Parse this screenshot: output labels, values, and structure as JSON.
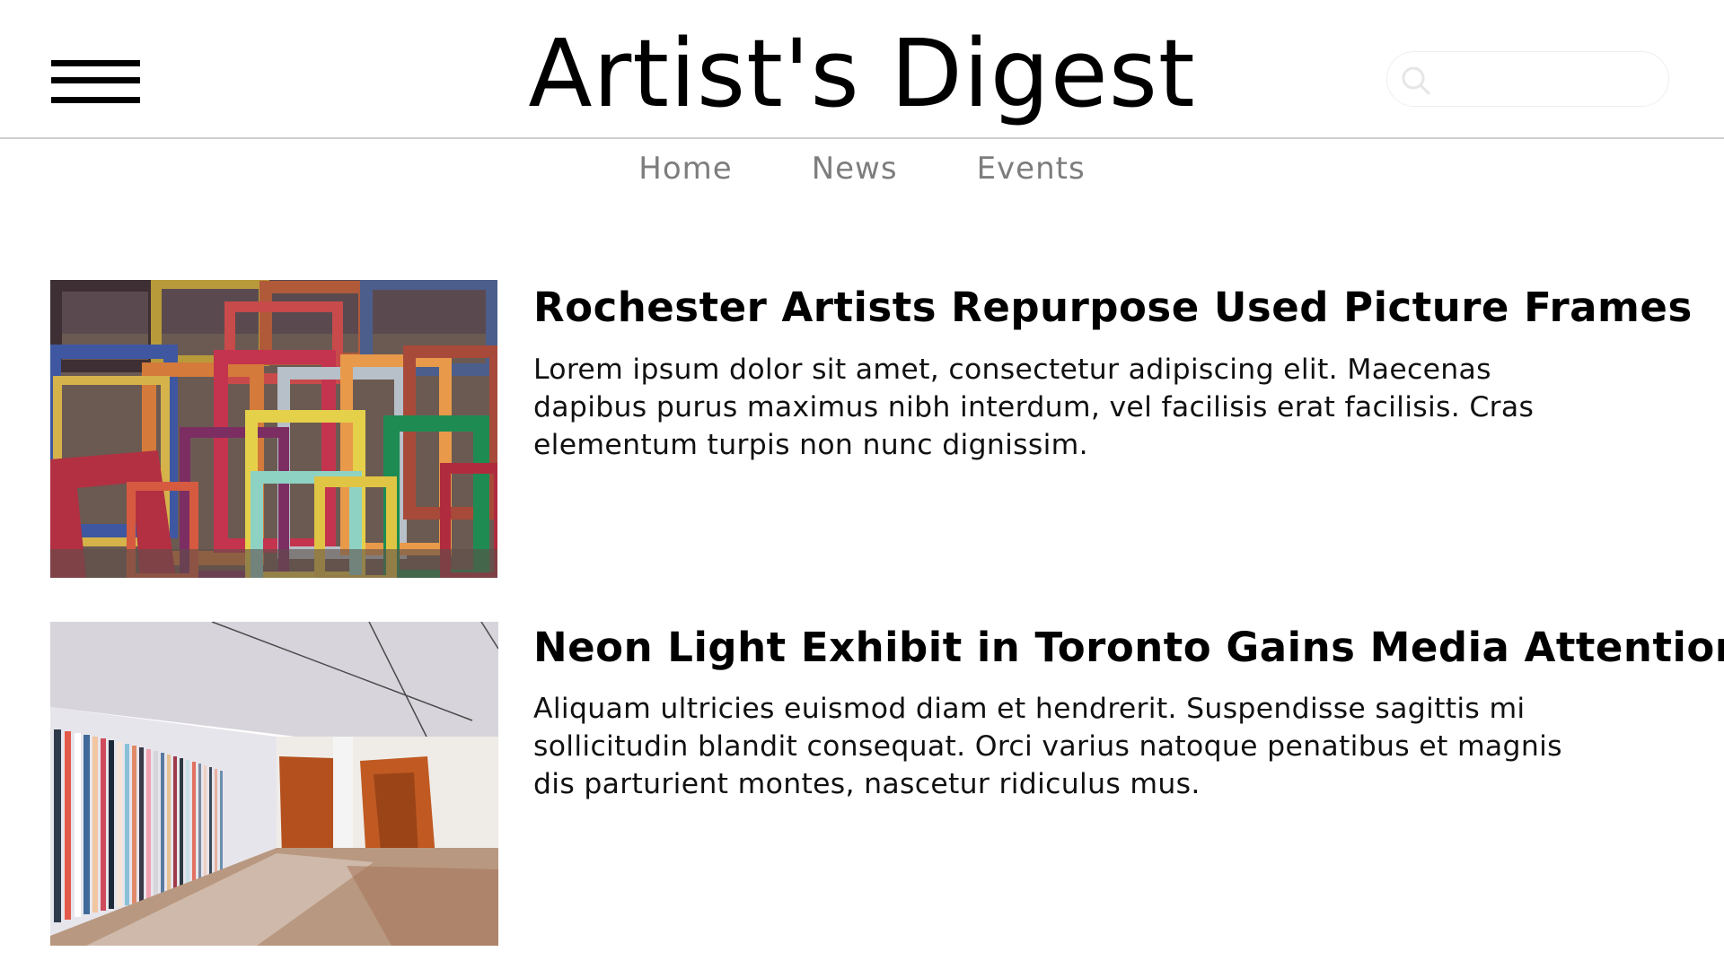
{
  "header": {
    "logo_text": "Artist's Digest",
    "menu_icon": "hamburger-icon",
    "search": {
      "placeholder": "",
      "value": "",
      "icon": "search-icon"
    }
  },
  "nav": {
    "items": [
      {
        "label": "Home"
      },
      {
        "label": "News"
      },
      {
        "label": "Events"
      }
    ]
  },
  "articles": [
    {
      "title": "Rochester Artists Repurpose Used Picture Frames",
      "body": "Lorem ipsum dolor sit amet, consectetur adipiscing elit. Maecenas dapibus purus maximus nibh interdum, vel facilisis erat facilisis. Cras elementum turpis non nunc dignissim.",
      "image": "colorful-picture-frames-photo"
    },
    {
      "title": "Neon Light Exhibit in Toronto Gains Media Attention",
      "body": "Aliquam ultricies euismod diam et hendrerit. Suspendisse sagittis mi sollicitudin blandit consequat. Orci varius natoque penatibus et magnis dis parturient montes, nascetur ridiculus mus.",
      "image": "neon-gallery-exhibit-photo"
    }
  ],
  "colors": {
    "nav_text": "#7d7d7d",
    "divider": "#cfcfcf",
    "text": "#111111"
  }
}
